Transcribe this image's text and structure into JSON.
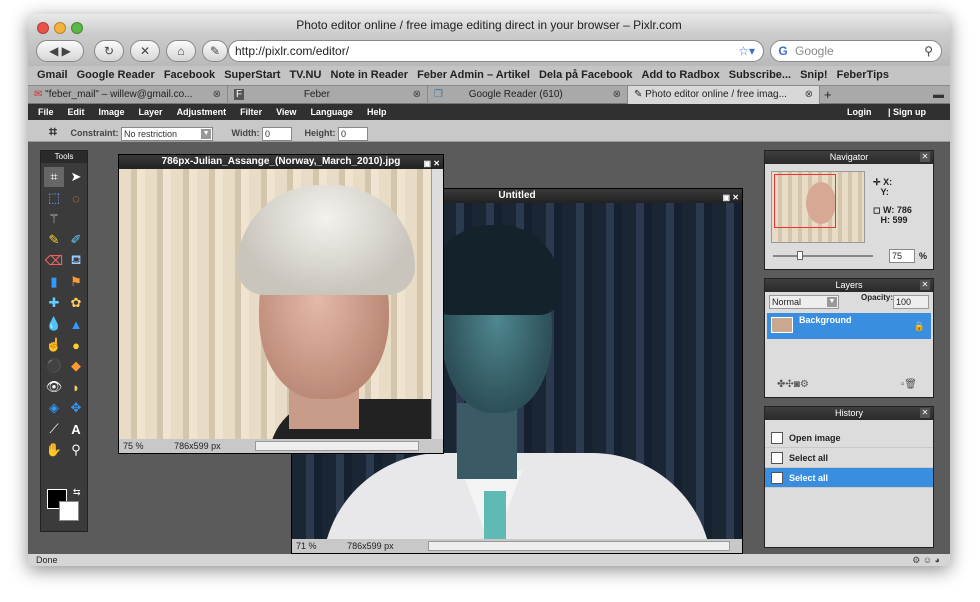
{
  "browser": {
    "title": "Photo editor online / free image editing direct in your browser – Pixlr.com",
    "url": "http://pixlr.com/editor/",
    "search_placeholder": "Google",
    "bookmarks": [
      "Gmail",
      "Google Reader",
      "Facebook",
      "SuperStart",
      "TV.NU",
      "Note in Reader",
      "Feber Admin – Artikel",
      "Dela på Facebook",
      "Add to Radbox",
      "Subscribe...",
      "Snip!",
      "FeberTips"
    ],
    "tabs": [
      {
        "label": "\"feber_mail\" – willew@gmail.co..."
      },
      {
        "label": "Feber"
      },
      {
        "label": "Google Reader (610)"
      },
      {
        "label": "Photo editor online / free imag..."
      }
    ],
    "status": "Done"
  },
  "app": {
    "menu": [
      "File",
      "Edit",
      "Image",
      "Layer",
      "Adjustment",
      "Filter",
      "View",
      "Language",
      "Help"
    ],
    "login": "Login",
    "signup": "Sign up",
    "options": {
      "constraint_label": "Constraint:",
      "constraint_value": "No restriction",
      "width_label": "Width:",
      "width_value": "0",
      "height_label": "Height:",
      "height_value": "0"
    },
    "tools_title": "Tools",
    "windows": {
      "front": {
        "title": "786px-Julian_Assange_(Norway,_March_2010).jpg",
        "zoom": "75",
        "zoom_unit": "%",
        "size": "786x599 px"
      },
      "back": {
        "title": "Untitled",
        "zoom": "71",
        "zoom_unit": "%",
        "size": "786x599 px"
      }
    },
    "navigator": {
      "title": "Navigator",
      "x_label": "X:",
      "y_label": "Y:",
      "w_label": "W:",
      "w_value": "786",
      "h_label": "H:",
      "h_value": "599",
      "zoom": "75",
      "zoom_unit": "%"
    },
    "layers": {
      "title": "Layers",
      "mode": "Normal",
      "opacity_label": "Opacity:",
      "opacity": "100",
      "items": [
        {
          "label": "Background"
        }
      ]
    },
    "history": {
      "title": "History",
      "items": [
        {
          "label": "Open image"
        },
        {
          "label": "Select all"
        },
        {
          "label": "Select all"
        }
      ]
    }
  }
}
